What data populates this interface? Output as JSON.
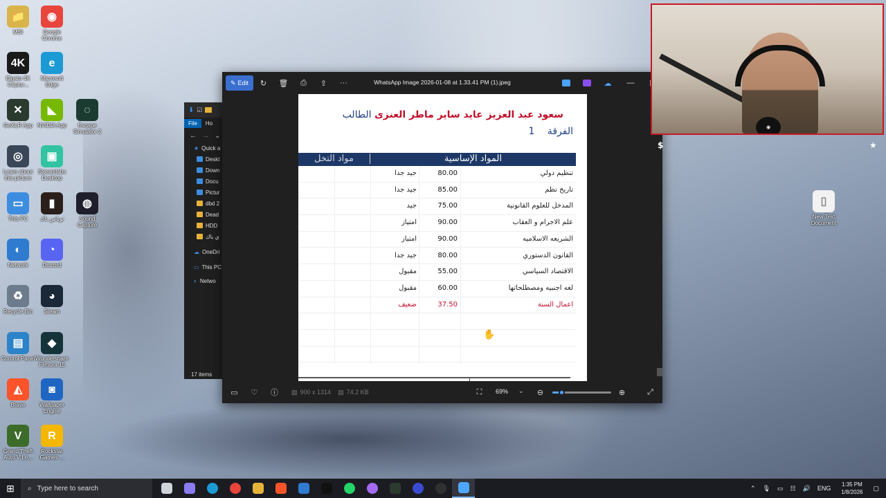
{
  "desktop": {
    "icons": [
      {
        "label": "MSI",
        "color": "#d9b44a",
        "glyph": "📁"
      },
      {
        "label": "Google Chrome",
        "color": "#e8453c",
        "glyph": "◉"
      },
      {
        "label": "Elgato 4K Captur...",
        "color": "#1a1a1a",
        "glyph": "4K"
      },
      {
        "label": "Microsoft Edge",
        "color": "#1c9ad6",
        "glyph": "e"
      },
      {
        "label": "GoXLR App",
        "color": "#2b3a2e",
        "glyph": "✕"
      },
      {
        "label": "NVIDIA App",
        "color": "#76b900",
        "glyph": "◣"
      },
      {
        "label": "Escape Simulator 2",
        "color": "#1b3b30",
        "glyph": "◌"
      },
      {
        "label": "Learn about this picture",
        "color": "#3a4758",
        "glyph": "◎"
      },
      {
        "label": "Streamlabs Desktop",
        "color": "#31c3a2",
        "glyph": "▣"
      },
      {
        "label": "This PC",
        "color": "#3c8de0",
        "glyph": "▭"
      },
      {
        "label": "توباس باك",
        "color": "#2a1f1a",
        "glyph": "▮"
      },
      {
        "label": "Sound Capture",
        "color": "#1e1f2b",
        "glyph": "◍"
      },
      {
        "label": "Network",
        "color": "#2f7bd0",
        "glyph": "◐"
      },
      {
        "label": "Discord",
        "color": "#5865f2",
        "glyph": "◔"
      },
      {
        "label": "Recycle Bin",
        "color": "#6c7c8c",
        "glyph": "♻"
      },
      {
        "label": "Steam",
        "color": "#1b2838",
        "glyph": "◕"
      },
      {
        "label": "Control Panel",
        "color": "#2c83c8",
        "glyph": "▤"
      },
      {
        "label": "Wondershare Filmora 15",
        "color": "#14343a",
        "glyph": "◆"
      },
      {
        "label": "Brave",
        "color": "#fb542b",
        "glyph": "◭"
      },
      {
        "label": "Wallpaper Engine",
        "color": "#1f66c2",
        "glyph": "◙"
      },
      {
        "label": "Grand Theft Auto V Le...",
        "color": "#3d6b2a",
        "glyph": "V"
      },
      {
        "label": "Rockstar Games ...",
        "color": "#f5b700",
        "glyph": "R"
      },
      {
        "label": "New Text Document",
        "color": "#f2f2f2",
        "glyph": "▯"
      }
    ]
  },
  "explorer": {
    "ribbon": [
      "File",
      "Ho"
    ],
    "nav": [
      {
        "label": "Quick a",
        "kind": "star"
      },
      {
        "label": "Deskt",
        "kind": "blue"
      },
      {
        "label": "Down",
        "kind": "blue"
      },
      {
        "label": "Docu",
        "kind": "blue"
      },
      {
        "label": "Pictur",
        "kind": "blue"
      },
      {
        "label": "dbd 2",
        "kind": "folder"
      },
      {
        "label": "Dead",
        "kind": "folder"
      },
      {
        "label": "HDD",
        "kind": "folder"
      },
      {
        "label": "ي باك",
        "kind": "folder"
      },
      {
        "label": "OneDri",
        "kind": "cloud"
      },
      {
        "label": "This PC",
        "kind": "pc"
      },
      {
        "label": "Netwo",
        "kind": "net"
      }
    ],
    "status": "17 items"
  },
  "viewer": {
    "edit_label": "Edit",
    "title": "WhatsApp Image 2026-01-08 at 1.33.41 PM (1).jpeg",
    "dimensions": "900 x 1314",
    "file_size": "74.2 KB",
    "zoom": "69%",
    "zoom_level": 0.15
  },
  "document": {
    "student_label": "الطالب",
    "student_name": "سعود عبد العزيز عايد ساير ماطر العنزى",
    "year_label": "الفرقة",
    "year_value": "1",
    "header_basic": "المواد الإساسية",
    "header_elective": "مواد التخل",
    "rows": [
      {
        "subject": "تنظيم دولي",
        "score": "80.00",
        "grade": "جيد جدا",
        "fail": false
      },
      {
        "subject": "تاريخ نظم",
        "score": "85.00",
        "grade": "جيد جدا",
        "fail": false
      },
      {
        "subject": "المدخل للعلوم القانونية",
        "score": "75.00",
        "grade": "جيد",
        "fail": false
      },
      {
        "subject": "علم الاجرام و العقاب",
        "score": "90.00",
        "grade": "امتياز",
        "fail": false
      },
      {
        "subject": "الشريعه الاسلاميه",
        "score": "90.00",
        "grade": "امتياز",
        "fail": false
      },
      {
        "subject": "القانون الدستوري",
        "score": "80.00",
        "grade": "جيد جدا",
        "fail": false
      },
      {
        "subject": "الاقتصاد السياسي",
        "score": "55.00",
        "grade": "مقبول",
        "fail": false
      },
      {
        "subject": "لغه اجنبيه ومصطلحاتها",
        "score": "60.00",
        "grade": "مقبول",
        "fail": false
      },
      {
        "subject": "اعمال السنة",
        "score": "37.50",
        "grade": "ضعيف",
        "fail": true
      },
      {
        "subject": "",
        "score": "",
        "grade": "",
        "fail": false
      },
      {
        "subject": "",
        "score": "",
        "grade": "",
        "fail": false
      },
      {
        "subject": "",
        "score": "",
        "grade": "",
        "fail": false
      }
    ]
  },
  "taskbar": {
    "search_placeholder": "Type here to search",
    "language": "ENG",
    "time": "1:35 PM",
    "date": "1/8/2026",
    "apps": [
      {
        "name": "task-view",
        "color": "#cfd3da"
      },
      {
        "name": "copilot",
        "color": "#8a7cf5"
      },
      {
        "name": "edge",
        "color": "#1c9ad6"
      },
      {
        "name": "chrome",
        "color": "#e8453c"
      },
      {
        "name": "file-explorer",
        "color": "#e6b33a"
      },
      {
        "name": "brave",
        "color": "#fb542b"
      },
      {
        "name": "mail",
        "color": "#2f7bd0"
      },
      {
        "name": "tiktok",
        "color": "#111111"
      },
      {
        "name": "whatsapp",
        "color": "#25d366"
      },
      {
        "name": "messenger",
        "color": "#a46bf5"
      },
      {
        "name": "goxlr",
        "color": "#2b3a2e"
      },
      {
        "name": "media-player",
        "color": "#3a4bd0"
      },
      {
        "name": "obs",
        "color": "#303030"
      },
      {
        "name": "photos",
        "color": "#4ea7ff"
      }
    ]
  }
}
